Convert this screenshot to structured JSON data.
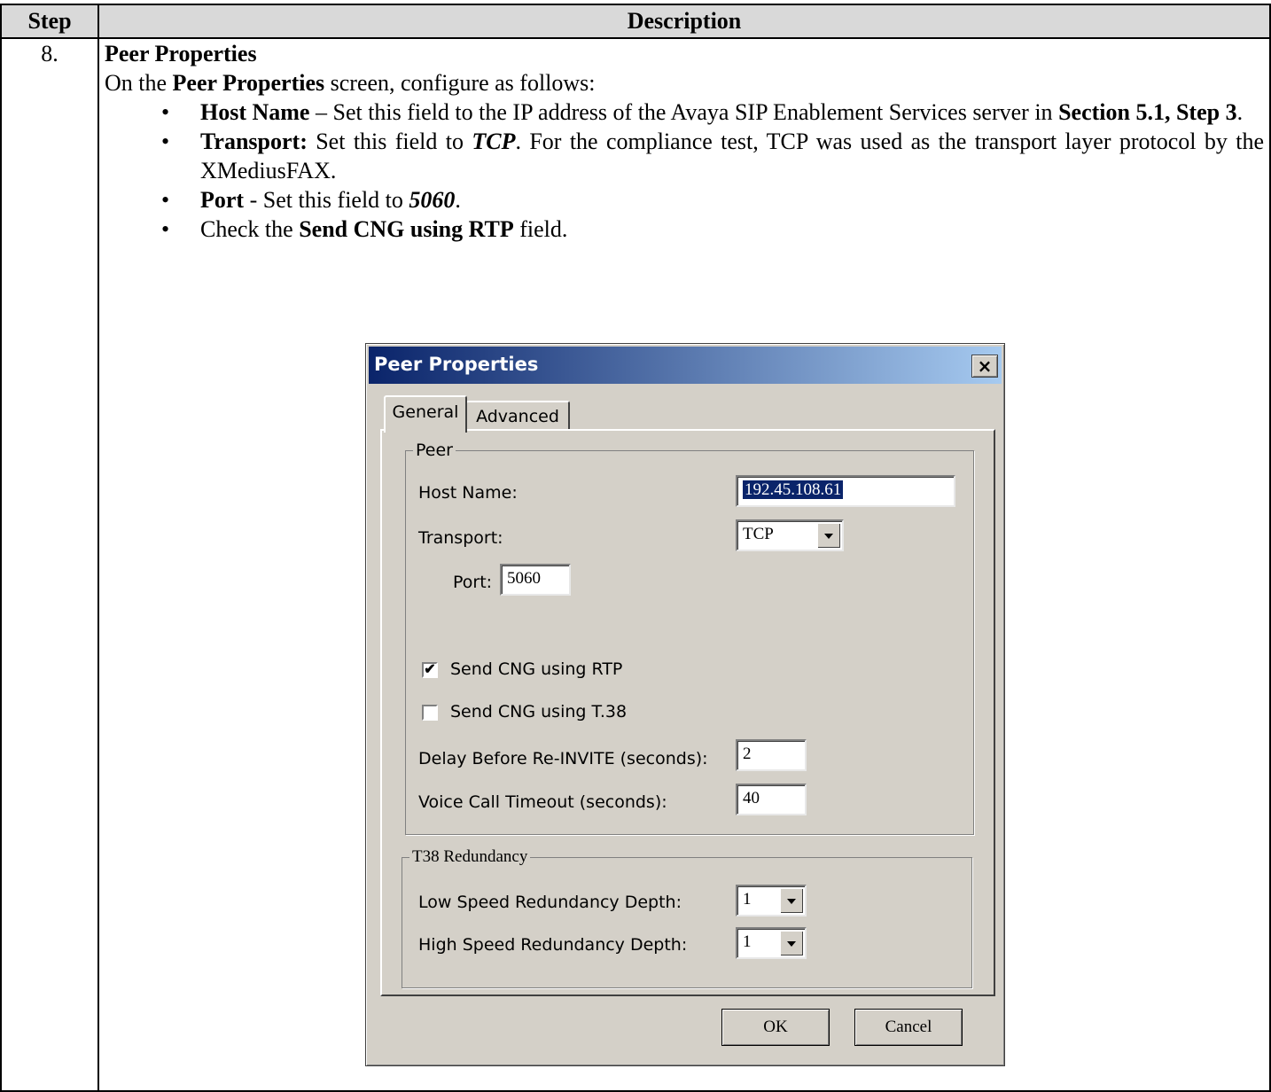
{
  "table": {
    "header_step": "Step",
    "header_description": "Description",
    "step_number": "8.",
    "section_title": "Peer Properties",
    "intro": {
      "prefix": "On the ",
      "bold": "Peer Properties",
      "suffix": " screen, configure as follows:"
    },
    "bullets": [
      {
        "bold": "Host Name",
        "text": " – Set this field to the IP address of the Avaya SIP Enablement Services server in ",
        "bold2": "Section 5.1, Step 3",
        "text2": "."
      },
      {
        "bold": "Transport:",
        "text": " Set this field to ",
        "bold_italic": "TCP",
        "text2": ". For the compliance test, TCP was used as the transport layer protocol by the XMediusFAX."
      },
      {
        "bold": "Port",
        "text": " - Set this field to ",
        "bold_italic": "5060",
        "text2": "."
      },
      {
        "prefix": "Check the ",
        "bold": "Send CNG using RTP",
        "text": " field."
      }
    ]
  },
  "dialog": {
    "title": "Peer Properties",
    "close_glyph": "×",
    "tabs": [
      "General",
      "Advanced"
    ],
    "peer_group": {
      "legend": "Peer",
      "host_name_label": "Host Name:",
      "host_name_value": "192.45.108.61",
      "transport_label": "Transport:",
      "transport_value": "TCP",
      "port_label": "Port:",
      "port_value": "5060",
      "send_cng_rtp_label": "Send CNG using RTP",
      "send_cng_rtp_checked": true,
      "send_cng_t38_label": "Send CNG using T.38",
      "send_cng_t38_checked": false,
      "delay_label": "Delay Before Re-INVITE (seconds):",
      "delay_value": "2",
      "voice_timeout_label": "Voice Call Timeout (seconds):",
      "voice_timeout_value": "40"
    },
    "t38_group": {
      "legend": "T38 Redundancy",
      "low_speed_label": "Low Speed Redundancy Depth:",
      "low_speed_value": "1",
      "high_speed_label": "High Speed Redundancy Depth:",
      "high_speed_value": "1"
    },
    "buttons": {
      "ok": "OK",
      "cancel": "Cancel"
    },
    "check_glyph": "✔"
  },
  "colors": {
    "title_gradient_start": "#0a246a",
    "title_gradient_end": "#a6caf0",
    "dialog_face": "#d4d0c8",
    "header_fill": "#d9d9d9"
  }
}
